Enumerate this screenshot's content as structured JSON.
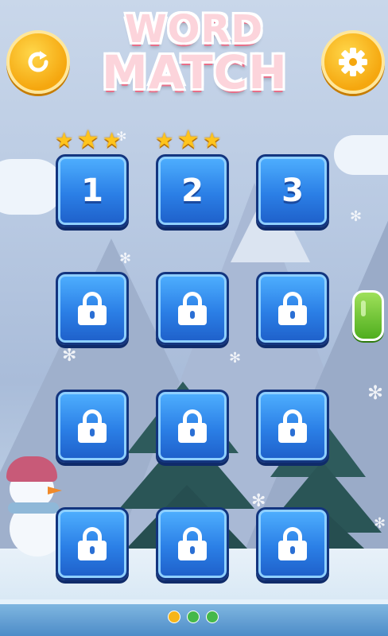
{
  "title": {
    "line1": "WORD",
    "line2": "MATCH"
  },
  "top_buttons": {
    "restart_icon": "restart-icon",
    "settings_icon": "gear-icon"
  },
  "levels": [
    {
      "label": "1",
      "locked": false,
      "stars": 3
    },
    {
      "label": "2",
      "locked": false,
      "stars": 3
    },
    {
      "label": "3",
      "locked": false,
      "stars": 0
    },
    {
      "label": "",
      "locked": true
    },
    {
      "label": "",
      "locked": true
    },
    {
      "label": "",
      "locked": true
    },
    {
      "label": "",
      "locked": true
    },
    {
      "label": "",
      "locked": true
    },
    {
      "label": "",
      "locked": true
    },
    {
      "label": "",
      "locked": true
    },
    {
      "label": "",
      "locked": true
    },
    {
      "label": "",
      "locked": true
    }
  ],
  "pagination": {
    "current_page": 1,
    "total_pages": 3
  },
  "colors": {
    "active_dot": "#f6b51a",
    "inactive_dot": "#45b84a",
    "tile_blue": "#2b7fe6",
    "star_gold": "#ffc41c"
  }
}
